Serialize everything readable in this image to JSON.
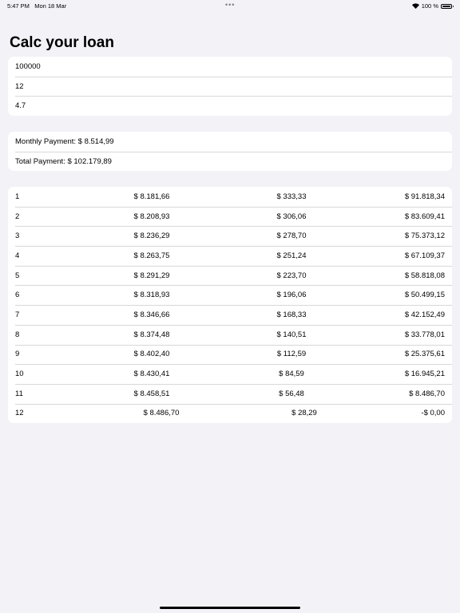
{
  "status_bar": {
    "time": "5:47 PM",
    "date": "Mon 18 Mar",
    "dots": "•••",
    "battery": "100 %",
    "wifi_icon": "wifi-icon",
    "battery_icon": "battery-icon"
  },
  "title": "Calc your loan",
  "inputs": {
    "amount": "100000",
    "months": "12",
    "rate": "4.7"
  },
  "results": {
    "monthly": "Monthly Payment: $ 8.514,99",
    "total": "Total Payment: $ 102.179,89"
  },
  "schedule": [
    {
      "n": "1",
      "principal": "$ 8.181,66",
      "interest": "$ 333,33",
      "balance": "$ 91.818,34"
    },
    {
      "n": "2",
      "principal": "$ 8.208,93",
      "interest": "$ 306,06",
      "balance": "$ 83.609,41"
    },
    {
      "n": "3",
      "principal": "$ 8.236,29",
      "interest": "$ 278,70",
      "balance": "$ 75.373,12"
    },
    {
      "n": "4",
      "principal": "$ 8.263,75",
      "interest": "$ 251,24",
      "balance": "$ 67.109,37"
    },
    {
      "n": "5",
      "principal": "$ 8.291,29",
      "interest": "$ 223,70",
      "balance": "$ 58.818,08"
    },
    {
      "n": "6",
      "principal": "$ 8.318,93",
      "interest": "$ 196,06",
      "balance": "$ 50.499,15"
    },
    {
      "n": "7",
      "principal": "$ 8.346,66",
      "interest": "$ 168,33",
      "balance": "$ 42.152,49"
    },
    {
      "n": "8",
      "principal": "$ 8.374,48",
      "interest": "$ 140,51",
      "balance": "$ 33.778,01"
    },
    {
      "n": "9",
      "principal": "$ 8.402,40",
      "interest": "$ 112,59",
      "balance": "$ 25.375,61"
    },
    {
      "n": "10",
      "principal": "$ 8.430,41",
      "interest": "$ 84,59",
      "balance": "$ 16.945,21"
    },
    {
      "n": "11",
      "principal": "$ 8.458,51",
      "interest": "$ 56,48",
      "balance": "$ 8.486,70"
    },
    {
      "n": "12",
      "principal": "$ 8.486,70",
      "interest": "$ 28,29",
      "balance": "-$ 0,00"
    }
  ]
}
